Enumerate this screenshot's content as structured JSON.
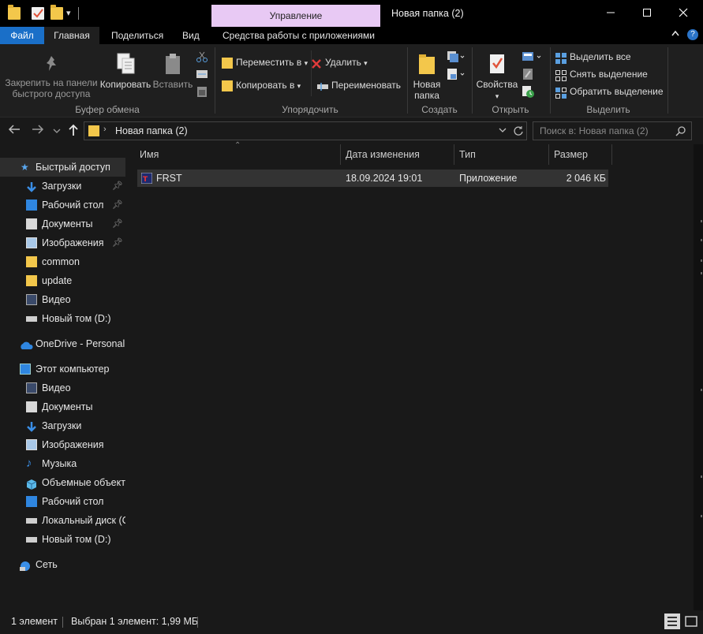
{
  "titlebar": {
    "context_tab": "Управление",
    "window_title": "Новая папка (2)",
    "minimize": "—",
    "maximize": "☐",
    "close": "✕",
    "qa_dropdown": "▾"
  },
  "tabs": {
    "file": "Файл",
    "home": "Главная",
    "share": "Поделиться",
    "view": "Вид",
    "app_tools": "Средства работы с приложениями",
    "collapse": "⌃",
    "help": "?"
  },
  "ribbon": {
    "clipboard": {
      "label": "Буфер обмена",
      "pin": "Закрепить на панели быстрого доступа",
      "copy": "Копировать",
      "paste": "Вставить"
    },
    "organize": {
      "label": "Упорядочить",
      "move_to": "Переместить в",
      "copy_to": "Копировать в",
      "delete": "Удалить",
      "rename": "Переименовать"
    },
    "create": {
      "label": "Создать",
      "new_folder_line1": "Новая",
      "new_folder_line2": "папка"
    },
    "open": {
      "label": "Открыть",
      "properties": "Свойства"
    },
    "select": {
      "label": "Выделить",
      "select_all": "Выделить все",
      "select_none": "Снять выделение",
      "invert": "Обратить выделение"
    }
  },
  "address": {
    "path": "Новая папка (2)",
    "search_placeholder": "Поиск в: Новая папка (2)"
  },
  "nav": {
    "quick_access": "Быстрый доступ",
    "downloads": "Загрузки",
    "desktop": "Рабочий стол",
    "documents": "Документы",
    "pictures": "Изображения",
    "common": "common",
    "update": "update",
    "video": "Видео",
    "volume_d": "Новый том (D:)",
    "onedrive": "OneDrive - Personal",
    "this_pc": "Этот компьютер",
    "pc_video": "Видео",
    "pc_documents": "Документы",
    "pc_downloads": "Загрузки",
    "pc_pictures": "Изображения",
    "pc_music": "Музыка",
    "pc_3d": "Объемные объекты",
    "pc_desktop": "Рабочий стол",
    "pc_local_c": "Локальный диск (C:)",
    "pc_volume_d": "Новый том (D:)",
    "network": "Сеть"
  },
  "columns": {
    "name": "Имя",
    "modified": "Дата изменения",
    "type": "Тип",
    "size": "Размер"
  },
  "files": [
    {
      "name": "FRST",
      "modified": "18.09.2024 19:01",
      "type": "Приложение",
      "size": "2 046 КБ"
    }
  ],
  "status": {
    "count": "1 элемент",
    "selected": "Выбран 1 элемент: 1,99 МБ"
  },
  "colors": {
    "accent": "#1a6fc8",
    "context_tab": "#e8c9f4",
    "folder": "#f3c74b"
  }
}
